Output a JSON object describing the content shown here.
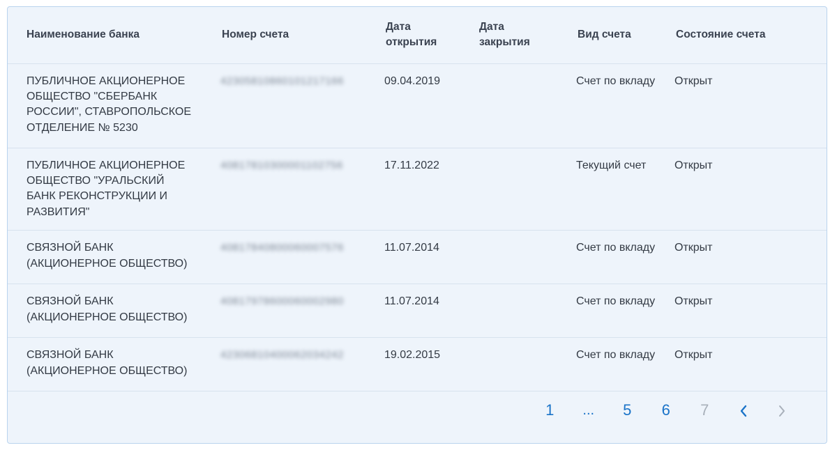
{
  "table": {
    "headers": [
      "Наименование банка",
      "Номер счета",
      "Дата открытия",
      "Дата закрытия",
      "Вид счета",
      "Состояние счета"
    ],
    "rows": [
      {
        "bank": "ПУБЛИЧНОЕ АКЦИОНЕРНОЕ ОБЩЕСТВО \"СБЕРБАНК РОССИИ\", СТАВРОПОЛЬСКОЕ ОТДЕЛЕНИЕ № 5230",
        "account": "42305810860101217166",
        "opened": "09.04.2019",
        "closed": "",
        "type": "Счет по вкладу",
        "status": "Открыт"
      },
      {
        "bank": "ПУБЛИЧНОЕ АКЦИОНЕРНОЕ ОБЩЕСТВО \"УРАЛЬСКИЙ БАНК РЕКОНСТРУКЦИИ И РАЗВИТИЯ\"",
        "account": "40817810300001102756",
        "opened": "17.11.2022",
        "closed": "",
        "type": "Текущий счет",
        "status": "Открыт"
      },
      {
        "bank": "СВЯЗНОЙ БАНК (АКЦИОНЕРНОЕ ОБЩЕСТВО)",
        "account": "40817840800060007576",
        "opened": "11.07.2014",
        "closed": "",
        "type": "Счет по вкладу",
        "status": "Открыт"
      },
      {
        "bank": "СВЯЗНОЙ БАНК (АКЦИОНЕРНОЕ ОБЩЕСТВО)",
        "account": "40817978600060002980",
        "opened": "11.07.2014",
        "closed": "",
        "type": "Счет по вкладу",
        "status": "Открыт"
      },
      {
        "bank": "СВЯЗНОЙ БАНК (АКЦИОНЕРНОЕ ОБЩЕСТВО)",
        "account": "42306810400062034242",
        "opened": "19.02.2015",
        "closed": "",
        "type": "Счет по вкладу",
        "status": "Открыт"
      }
    ]
  },
  "pagination": {
    "first": "1",
    "ellipsis": "...",
    "pages": [
      "5",
      "6",
      "7"
    ],
    "current": "7",
    "prev_icon": "chevron-left-icon",
    "next_icon": "chevron-right-icon"
  },
  "colors": {
    "panel_bg": "#eef4fb",
    "border": "#b9d3ee",
    "link": "#1a73c8",
    "disabled": "#a8b0ba"
  }
}
